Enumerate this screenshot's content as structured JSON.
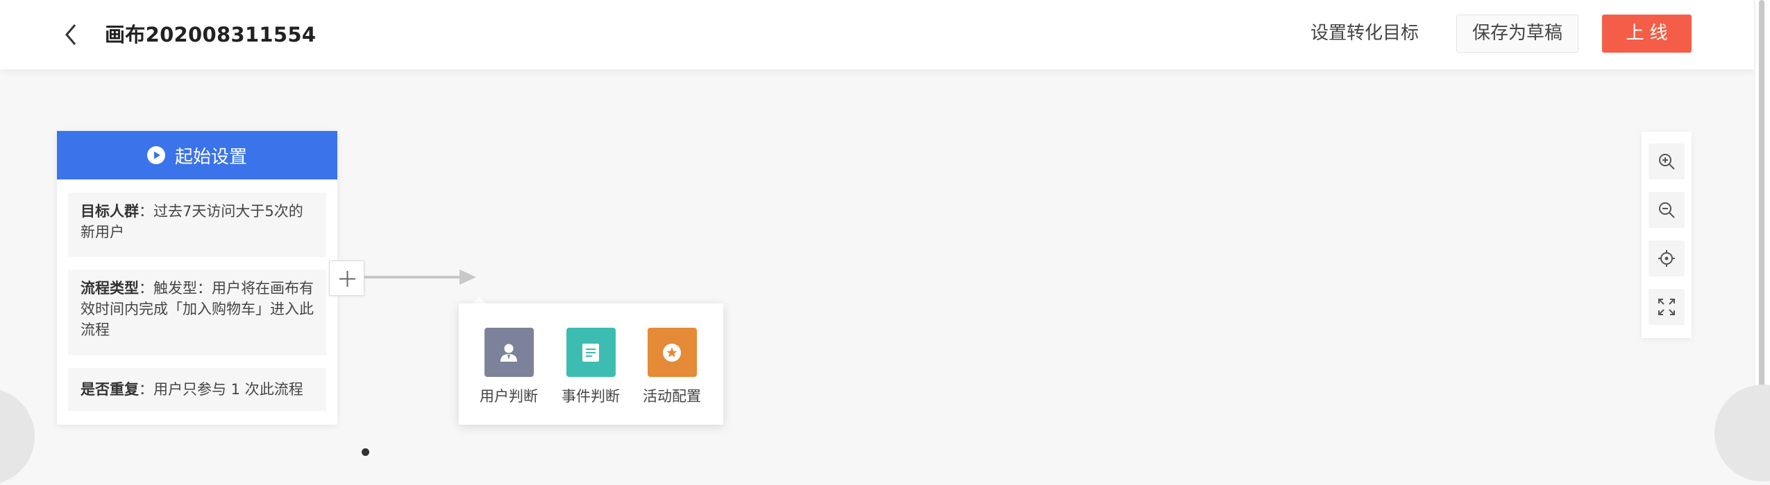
{
  "header": {
    "title": "画布202008311554",
    "goal_link": "设置转化目标",
    "save_draft": "保存为草稿",
    "go_online": "上线"
  },
  "start_node": {
    "title": "起始设置",
    "target_label": "目标人群",
    "target_value": "过去7天访问大于5次的新用户",
    "flow_type_label": "流程类型",
    "flow_type_value": "触发型：用户将在画布有效时间内完成「加入购物车」进入此流程",
    "repeat_label": "是否重复",
    "repeat_value": "用户只参与 1 次此流程"
  },
  "node_menu": {
    "items": [
      {
        "label": "用户判断",
        "icon": "user-icon",
        "color": "#7c8299"
      },
      {
        "label": "事件判断",
        "icon": "document-icon",
        "color": "#3dbdb1"
      },
      {
        "label": "活动配置",
        "icon": "star-icon",
        "color": "#e58a36"
      }
    ]
  },
  "toolbar": {
    "icons": [
      "zoom-in-icon",
      "zoom-out-icon",
      "locate-icon",
      "fullscreen-icon"
    ]
  },
  "colors": {
    "primary": "#3b73ea",
    "danger": "#f45e48"
  }
}
